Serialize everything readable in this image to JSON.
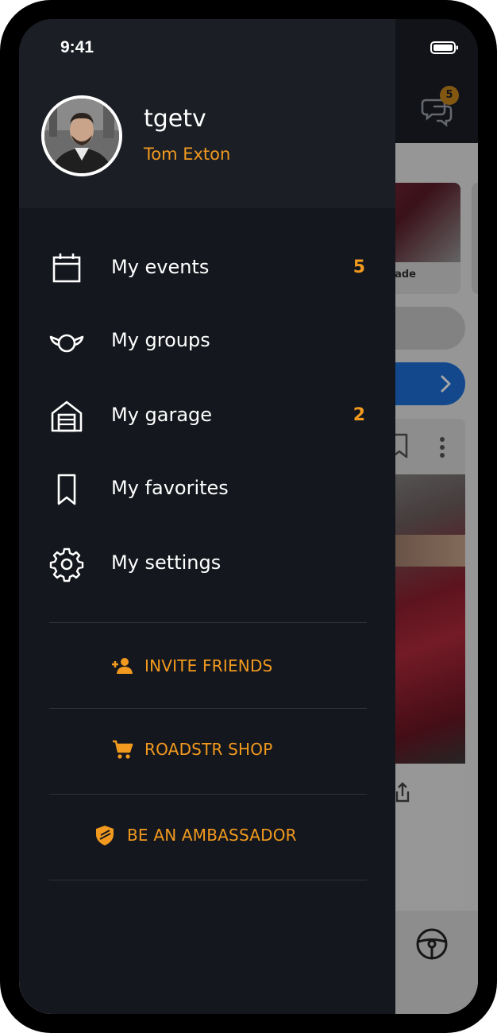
{
  "status_bar": {
    "time": "9:41"
  },
  "background_app": {
    "messages_badge": "5",
    "card_label": "ade"
  },
  "drawer": {
    "profile": {
      "username": "tgetv",
      "full_name": "Tom Exton"
    },
    "menu": [
      {
        "icon": "calendar-icon",
        "label": "My events",
        "badge": "5"
      },
      {
        "icon": "groups-icon",
        "label": "My groups",
        "badge": ""
      },
      {
        "icon": "garage-icon",
        "label": "My garage",
        "badge": "2"
      },
      {
        "icon": "bookmark-icon",
        "label": "My favorites",
        "badge": ""
      },
      {
        "icon": "gear-icon",
        "label": "My settings",
        "badge": ""
      }
    ],
    "actions": [
      {
        "icon": "add-person-icon",
        "label": "INVITE FRIENDS"
      },
      {
        "icon": "cart-icon",
        "label": "ROADSTR SHOP"
      },
      {
        "icon": "shield-icon",
        "label": "BE AN AMBASSADOR"
      }
    ]
  },
  "colors": {
    "accent": "#f29a1f",
    "drawer_background": "#14171d",
    "drawer_header": "#1b1e25",
    "primary_blue": "#1e6fd9"
  }
}
